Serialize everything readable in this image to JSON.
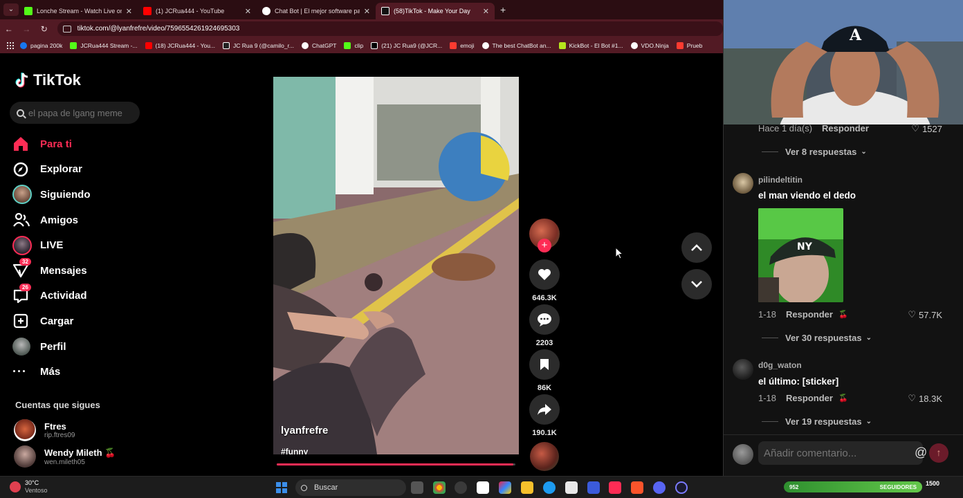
{
  "browser": {
    "tabs": [
      {
        "title": "Lonche Stream - Watch Live on",
        "active": false,
        "color": "#53fc18",
        "icon": "kick-icon"
      },
      {
        "title": "(1) JCRua444 - YouTube",
        "active": false,
        "color": "#ff0000",
        "icon": "youtube-icon"
      },
      {
        "title": "Chat Bot | El mejor software pa",
        "active": false,
        "color": "#ffffff",
        "icon": "chatbot-icon"
      },
      {
        "title": "(58)TikTok - Make Your Day",
        "active": true,
        "color": "#ffffff",
        "icon": "tiktok-icon"
      }
    ],
    "new_tab": "+",
    "url": "tiktok.com/@lyanfrefre/video/7596554261924695303",
    "bookmarks": [
      {
        "label": "pagina 200k",
        "color": "#1877f2"
      },
      {
        "label": "JCRua444 Stream -...",
        "color": "#53fc18"
      },
      {
        "label": "(18) JCRua444 - You...",
        "color": "#ff0000"
      },
      {
        "label": "JC Rua 9 (@camilo_r...",
        "color": "#ffffff"
      },
      {
        "label": "ChatGPT",
        "color": "#ffffff"
      },
      {
        "label": "clip",
        "color": "#53fc18"
      },
      {
        "label": "(21) JC Rua9 (@JCR...",
        "color": "#ffffff"
      },
      {
        "label": "emoji",
        "color": "#ff3b30"
      },
      {
        "label": "The best ChatBot an...",
        "color": "#ffffff"
      },
      {
        "label": "KickBot - El Bot #1...",
        "color": "#b5e61d"
      },
      {
        "label": "VDO.Ninja",
        "color": "#ffffff"
      },
      {
        "label": "Prueb",
        "color": "#ff3b30"
      }
    ]
  },
  "tiktok": {
    "logo": "TikTok",
    "search_placeholder": "el papa de lgang meme",
    "nav": [
      {
        "label": "Para ti",
        "icon": "home-icon",
        "active": true
      },
      {
        "label": "Explorar",
        "icon": "compass-icon"
      },
      {
        "label": "Siguiendo",
        "icon": "following-avatar-icon"
      },
      {
        "label": "Amigos",
        "icon": "friends-icon"
      },
      {
        "label": "LIVE",
        "icon": "live-icon"
      },
      {
        "label": "Mensajes",
        "icon": "messages-icon",
        "badge": "32"
      },
      {
        "label": "Actividad",
        "icon": "activity-icon",
        "badge": "26"
      },
      {
        "label": "Cargar",
        "icon": "upload-icon"
      },
      {
        "label": "Perfil",
        "icon": "profile-avatar-icon"
      },
      {
        "label": "Más",
        "icon": "more-icon"
      }
    ],
    "following_header": "Cuentas que sigues",
    "following": [
      {
        "name": "Ftres",
        "handle": "rip.ftres09"
      },
      {
        "name": "Wendy Mileth 🍒",
        "handle": "wen.mileth05"
      }
    ],
    "video": {
      "author": "lyanfrefre",
      "hashtag": "#funny",
      "progress": 0.99
    },
    "actions": {
      "likes": "646.3K",
      "comments": "2203",
      "saves": "86K",
      "shares": "190.1K"
    }
  },
  "comments": {
    "top": {
      "time": "Hace 1 día(s)",
      "reply": "Responder",
      "likes": "1527",
      "more": "Ver 8 respuestas"
    },
    "items": [
      {
        "user": "pilindeltitin",
        "text": "el man viendo el dedo",
        "date": "1-18",
        "reply": "Responder",
        "likes": "57.7K",
        "more": "Ver 30 respuestas"
      },
      {
        "user": "d0g_waton",
        "text": "el último: [sticker]",
        "date": "1-18",
        "reply": "Responder",
        "likes": "18.3K",
        "more": "Ver 19 respuestas"
      }
    ],
    "compose_placeholder": "Añadir comentario...",
    "mention_icon": "@"
  },
  "taskbar": {
    "temperature": "30°C",
    "condition": "Ventoso",
    "search": "Buscar",
    "stream_left": "952",
    "stream_label": "SEGUIDORES",
    "stream_right": "1500"
  }
}
